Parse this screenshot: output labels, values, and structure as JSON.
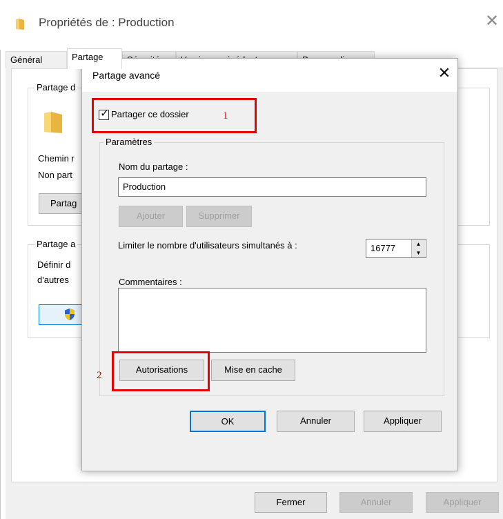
{
  "outer_window": {
    "title": "Propriétés de : Production",
    "tabs": [
      "Général",
      "Partage",
      "Sécurité",
      "Versions précédentes",
      "Personnaliser"
    ],
    "group_partage_label": "Partage d",
    "chemin_label": "Chemin r",
    "non_partage_label": "Non part",
    "partager_button": "Partag",
    "group_avance_label": "Partage a",
    "definir_label": "Définir d",
    "autres_label": "d'autres",
    "footer": {
      "fermer": "Fermer",
      "annuler": "Annuler",
      "appliquer": "Appliquer"
    }
  },
  "dialog": {
    "title": "Partage avancé",
    "share_checkbox_label": "Partager ce dossier",
    "share_checked": true,
    "parametres_label": "Paramètres",
    "share_name_label": "Nom du partage :",
    "share_name_value": "Production",
    "add_button": "Ajouter",
    "remove_button": "Supprimer",
    "limit_label": "Limiter le nombre d'utilisateurs simultanés à :",
    "limit_value": "16777",
    "comments_label": "Commentaires :",
    "comments_value": "",
    "permissions_button": "Autorisations",
    "cache_button": "Mise en cache",
    "ok_button": "OK",
    "cancel_button": "Annuler",
    "apply_button": "Appliquer"
  },
  "annotations": {
    "step1": "1",
    "step2": "2",
    "color": "#e60000"
  },
  "icons": {
    "title_icon": "folder-icon",
    "folder": "folder-icon",
    "shield": "shield-icon",
    "close": "close-icon"
  }
}
